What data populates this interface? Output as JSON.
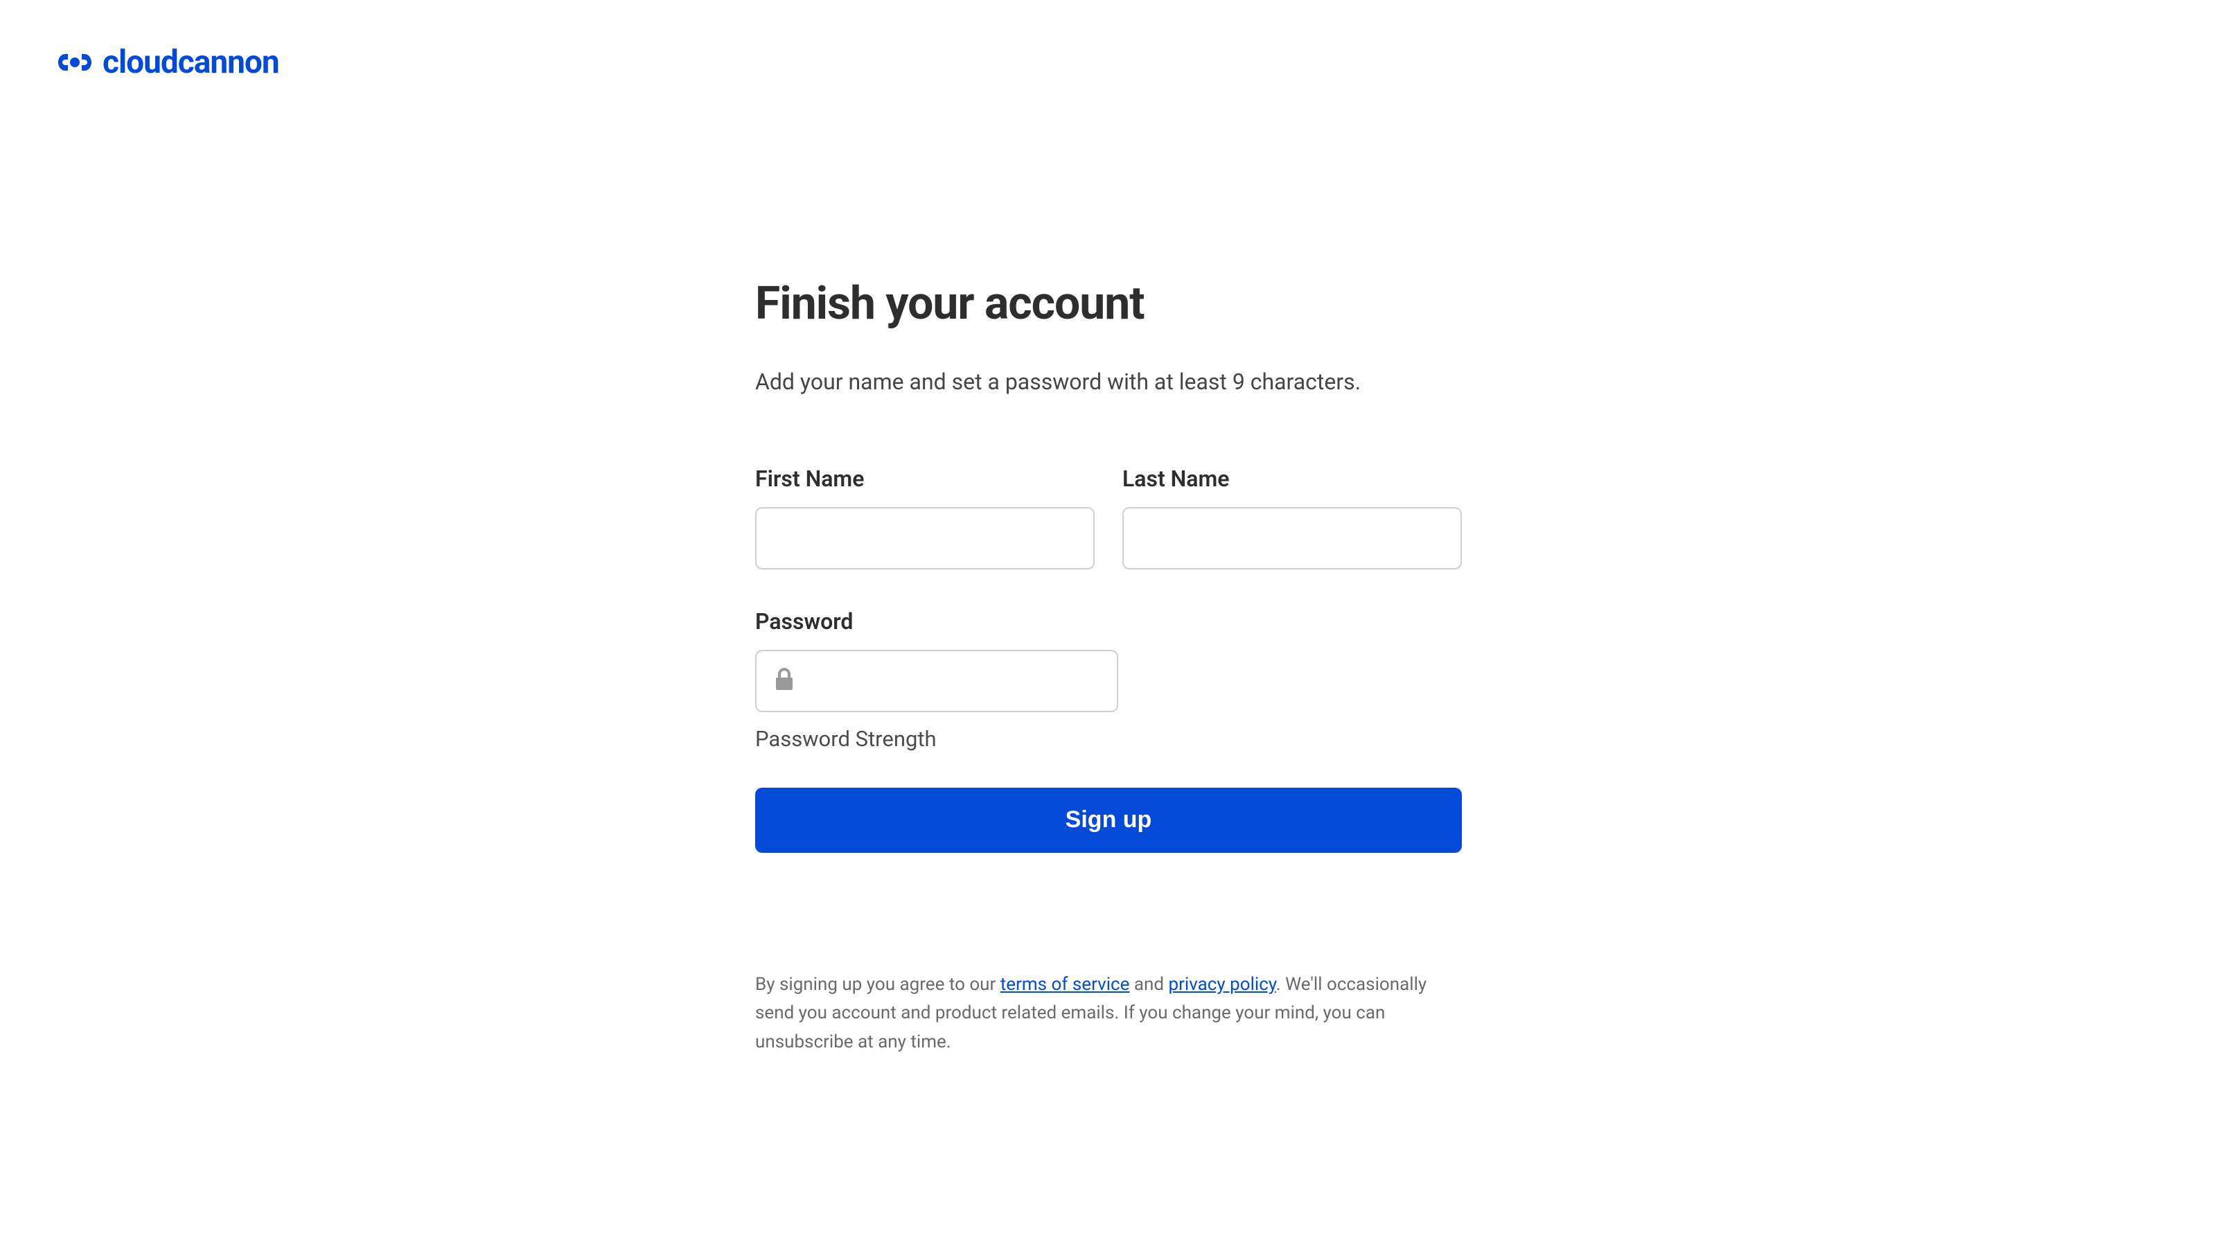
{
  "brand": {
    "name": "cloudcannon"
  },
  "page": {
    "title": "Finish your account",
    "subtitle": "Add your name and set a password with at least 9 characters."
  },
  "form": {
    "first_name": {
      "label": "First Name",
      "value": ""
    },
    "last_name": {
      "label": "Last Name",
      "value": ""
    },
    "password": {
      "label": "Password",
      "value": "",
      "strength_label": "Password Strength"
    },
    "submit_label": "Sign up"
  },
  "legal": {
    "prefix": "By signing up you agree to our ",
    "terms_link": "terms of service",
    "and": " and ",
    "privacy_link": "privacy policy",
    "suffix": ". We'll occasionally send you account and product related emails. If you change your mind, you can unsubscribe at any time."
  }
}
